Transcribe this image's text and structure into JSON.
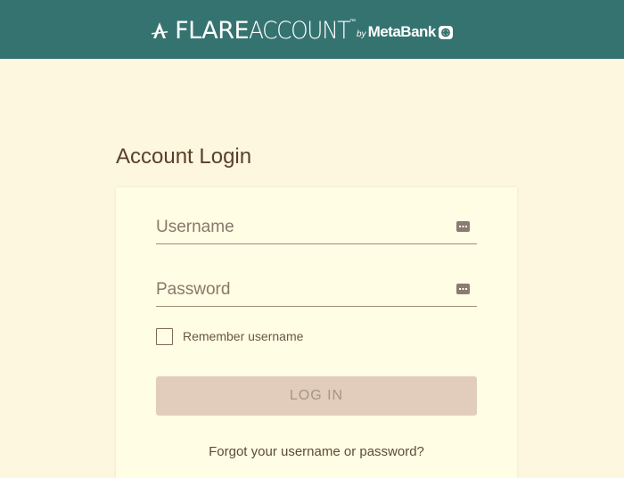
{
  "header": {
    "brand_primary": "FLARE",
    "brand_secondary": "ACCOUNT",
    "trademark": "™",
    "by": "by",
    "partner": "MetaBank",
    "background_color": "#357370"
  },
  "page": {
    "title": "Account Login",
    "background_color": "#fdf7df"
  },
  "form": {
    "username": {
      "value": "",
      "placeholder": "Username",
      "icon": "key-icon"
    },
    "password": {
      "value": "",
      "placeholder": "Password",
      "icon": "key-icon"
    },
    "remember": {
      "label": "Remember username",
      "checked": false
    },
    "login_button": {
      "label": "LOG IN",
      "color": "#e2cdbc"
    },
    "forgot_link": "Forgot your username or password?"
  }
}
